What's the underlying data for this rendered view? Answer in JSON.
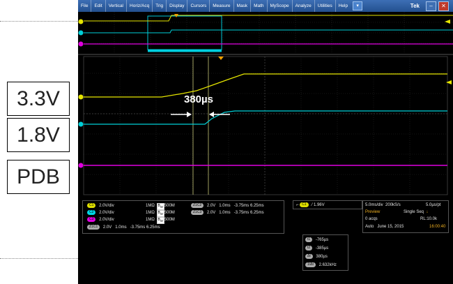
{
  "annotations": {
    "box_labels": [
      "3.3V",
      "1.8V",
      "PDB"
    ],
    "measurement": "380µs"
  },
  "menu": {
    "items": [
      "File",
      "Edit",
      "Vertical",
      "Horiz/Acq",
      "Trig",
      "Display",
      "Cursors",
      "Measure",
      "Mask",
      "Math",
      "MyScope",
      "Analyze",
      "Utilities",
      "Help"
    ],
    "brand": "Tek"
  },
  "channels": [
    {
      "chip": "C1",
      "scale": "2.0V/div",
      "impedance": "1MΩ",
      "bw": "500M"
    },
    {
      "chip": "C2",
      "scale": "2.0V/div",
      "impedance": "1MΩ",
      "bw": "500M"
    },
    {
      "chip": "C3",
      "scale": "2.0V/div",
      "impedance": "1MΩ",
      "bw": "500M"
    },
    {
      "chip": "Z1C1",
      "scale": "2.0V",
      "time": "1.0ms",
      "range": "-3.75ms 6.25ms"
    }
  ],
  "zooms": [
    {
      "chip": "Z1C2",
      "scale": "2.0V",
      "time": "1.0ms",
      "range": "-3.75ms 6.25ms"
    },
    {
      "chip": "Z1C3",
      "scale": "2.0V",
      "time": "1.0ms",
      "range": "-3.75ms 6.25ms"
    }
  ],
  "trigger": {
    "chip": "C1",
    "level": "1.96V"
  },
  "acquisition": {
    "horiz": "5.0ms/div",
    "rate": "200kS/s",
    "res": "5.0µs/pt",
    "mode": "Preview",
    "seq": "Single Seq",
    "acqs": "0 acqs",
    "rl": "RL:10.0k",
    "auto": "Auto",
    "date": "June 15, 2015",
    "time": "16:00:40"
  },
  "cursors": [
    {
      "chip": "t1",
      "value": "-765µs"
    },
    {
      "chip": "t2",
      "value": "-385µs"
    },
    {
      "chip": "Δt",
      "value": "380µs"
    },
    {
      "chip": "1/Δt",
      "value": "2.632kHz"
    }
  ],
  "colors": {
    "ch1": "#e6e600",
    "ch2": "#00d0d8",
    "ch3": "#e000e0",
    "menubar": "#2d5da0"
  }
}
